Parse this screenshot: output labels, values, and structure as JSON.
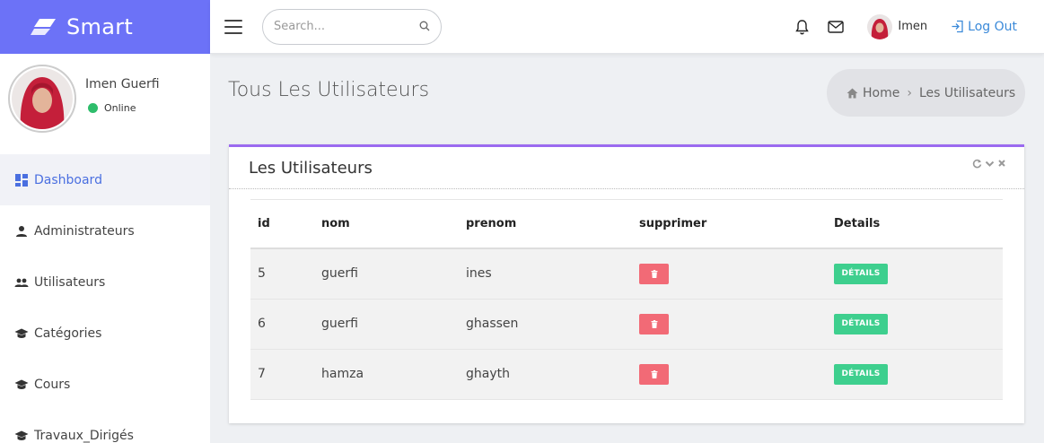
{
  "brand": {
    "name": "Smart",
    "color": "#6c72f7"
  },
  "topbar": {
    "search_placeholder": "Search...",
    "user_name": "Imen",
    "logout_label": "Log Out"
  },
  "sidebar": {
    "profile": {
      "name": "Imen Guerfi",
      "status": "Online"
    },
    "items": [
      {
        "label": "Dashboard",
        "icon": "dashboard-icon",
        "active": true
      },
      {
        "label": "Administrateurs",
        "icon": "person-icon"
      },
      {
        "label": "Utilisateurs",
        "icon": "people-icon"
      },
      {
        "label": "Catégories",
        "icon": "graduation-cap-icon"
      },
      {
        "label": "Cours",
        "icon": "graduation-cap-icon"
      },
      {
        "label": "Travaux_Dirigés",
        "icon": "graduation-cap-icon"
      }
    ]
  },
  "page": {
    "title": "Tous Les Utilisateurs",
    "breadcrumb": {
      "home": "Home",
      "current": "Les Utilisateurs"
    }
  },
  "card": {
    "title": "Les Utilisateurs",
    "accent_color": "#9b6af0",
    "columns": [
      "id",
      "nom",
      "prenom",
      "supprimer",
      "Details"
    ],
    "details_label": "DÉTAILS",
    "rows": [
      {
        "id": "5",
        "nom": "guerfi",
        "prenom": "ines"
      },
      {
        "id": "6",
        "nom": "guerfi",
        "prenom": "ghassen"
      },
      {
        "id": "7",
        "nom": "hamza",
        "prenom": "ghayth"
      }
    ]
  }
}
